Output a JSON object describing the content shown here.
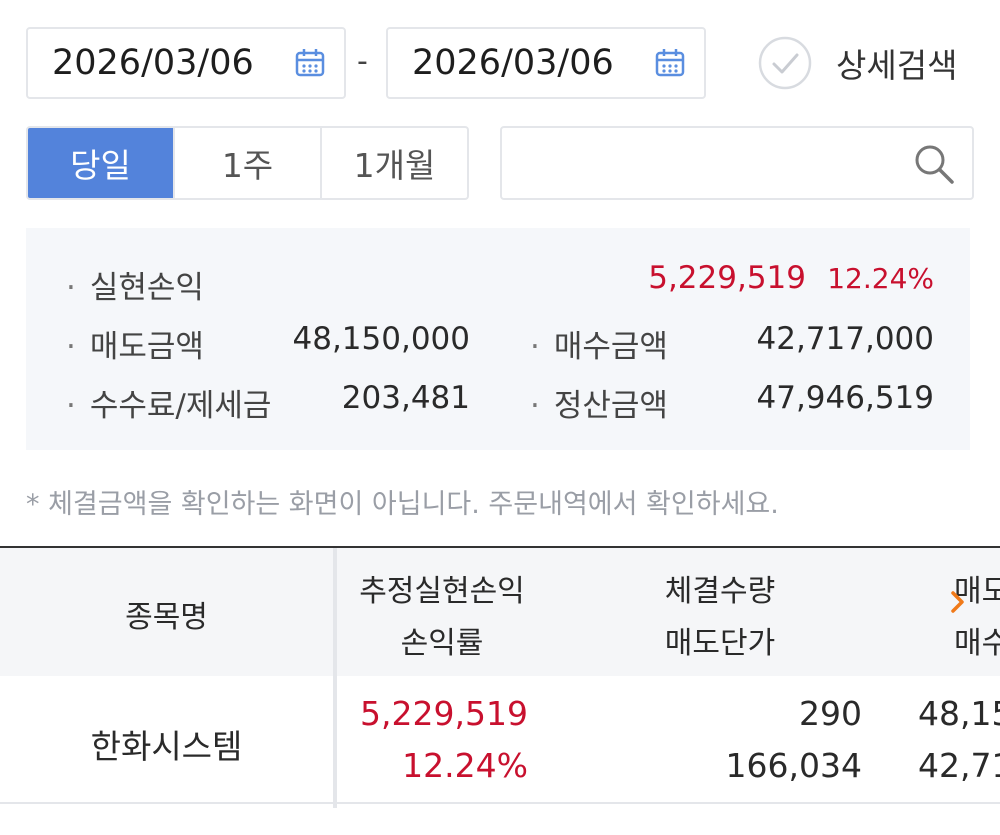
{
  "date_range": {
    "start": "2026/03/06",
    "separator": "-",
    "end": "2026/03/06"
  },
  "detail_search": {
    "label": "상세검색"
  },
  "period_tabs": [
    {
      "label": "당일",
      "active": true
    },
    {
      "label": "1주",
      "active": false
    },
    {
      "label": "1개월",
      "active": false
    }
  ],
  "search": {
    "value": ""
  },
  "summary": {
    "realized_pl": {
      "label": "실현손익",
      "value": "5,229,519",
      "rate": "12.24%"
    },
    "sell_amount": {
      "label": "매도금액",
      "value": "48,150,000"
    },
    "buy_amount": {
      "label": "매수금액",
      "value": "42,717,000"
    },
    "fees_taxes": {
      "label": "수수료/제세금",
      "value": "203,481"
    },
    "settlement": {
      "label": "정산금액",
      "value": "47,946,519"
    }
  },
  "note": "* 체결금액을 확인하는 화면이 아닙니다. 주문내역에서 확인하세요.",
  "table": {
    "headers": {
      "name": "종목명",
      "pl_line1": "추정실현손익",
      "pl_line2": "손익률",
      "qty_line1": "체결수량",
      "qty_line2": "매도단가",
      "amt_line1": "매도",
      "amt_line2": "매수"
    },
    "rows": [
      {
        "name": "한화시스템",
        "pl": "5,229,519",
        "rate": "12.24%",
        "qty": "290",
        "sell_price": "166,034",
        "sell_amt": "48,15",
        "buy_amt": "42,71"
      }
    ]
  },
  "colors": {
    "accent": "#5383db",
    "loss_profit_red": "#c8102e"
  }
}
